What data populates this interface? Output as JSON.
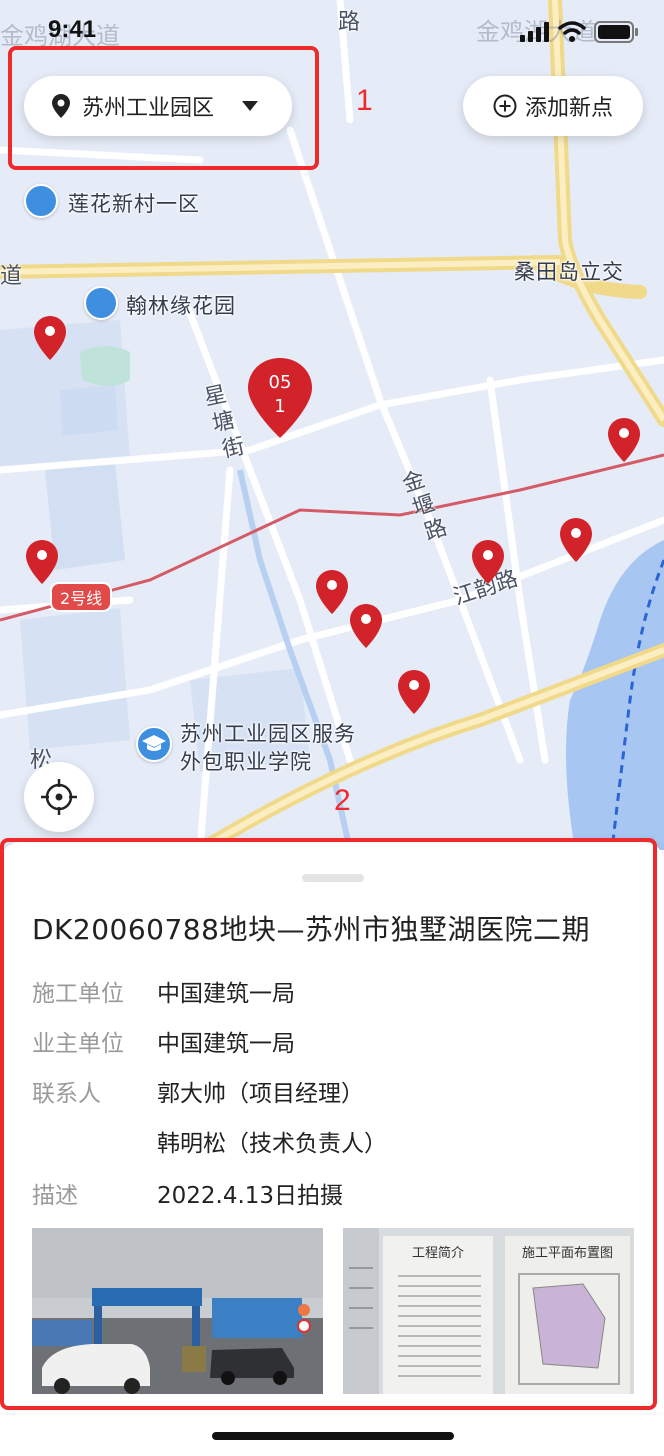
{
  "status_bar": {
    "time": "9:41"
  },
  "map": {
    "location_selector": {
      "label": "苏州工业园区"
    },
    "add_point_button": {
      "label": "添加新点"
    },
    "places": {
      "lianhua": "莲花新村一区",
      "hanlin": "翰林缘花园",
      "sangtian": "桑田岛立交",
      "college_line1": "苏州工业园区服务",
      "college_line2": "外包职业学院"
    },
    "roads": {
      "xingtang_1": "星",
      "xingtang_2": "塘",
      "xingtang_3": "街",
      "jinyan_1": "金",
      "jinyan_2": "堰",
      "jinyan_3": "路",
      "jiangyun": "江韵路",
      "top_road": "路",
      "left_road": "道",
      "left_bottom": "松",
      "top_left_faded": "金鸡湖大道",
      "top_right_faded": "金鸡湖大道"
    },
    "metro_line": "2号线",
    "cluster": {
      "line1": "05",
      "line2": "1"
    }
  },
  "annotations": {
    "label_1": "1",
    "label_2": "2"
  },
  "project": {
    "title": "DK20060788地块—苏州市独墅湖医院二期",
    "fields": {
      "construction_unit_label": "施工单位",
      "construction_unit_value": "中国建筑一局",
      "owner_unit_label": "业主单位",
      "owner_unit_value": "中国建筑一局",
      "contact_label": "联系人",
      "contact_1": "郭大帅（项目经理）",
      "contact_2": "韩明松（技术负责人）",
      "description_label": "描述",
      "description_value": "2022.4.13日拍摄"
    },
    "photo_sign_1": "工程简介",
    "photo_sign_2": "施工平面布置图"
  },
  "colors": {
    "pin": "#d3232a",
    "annotation": "#ee2b2b",
    "road_major": "#f1d98a",
    "water": "#a7c6f2"
  }
}
